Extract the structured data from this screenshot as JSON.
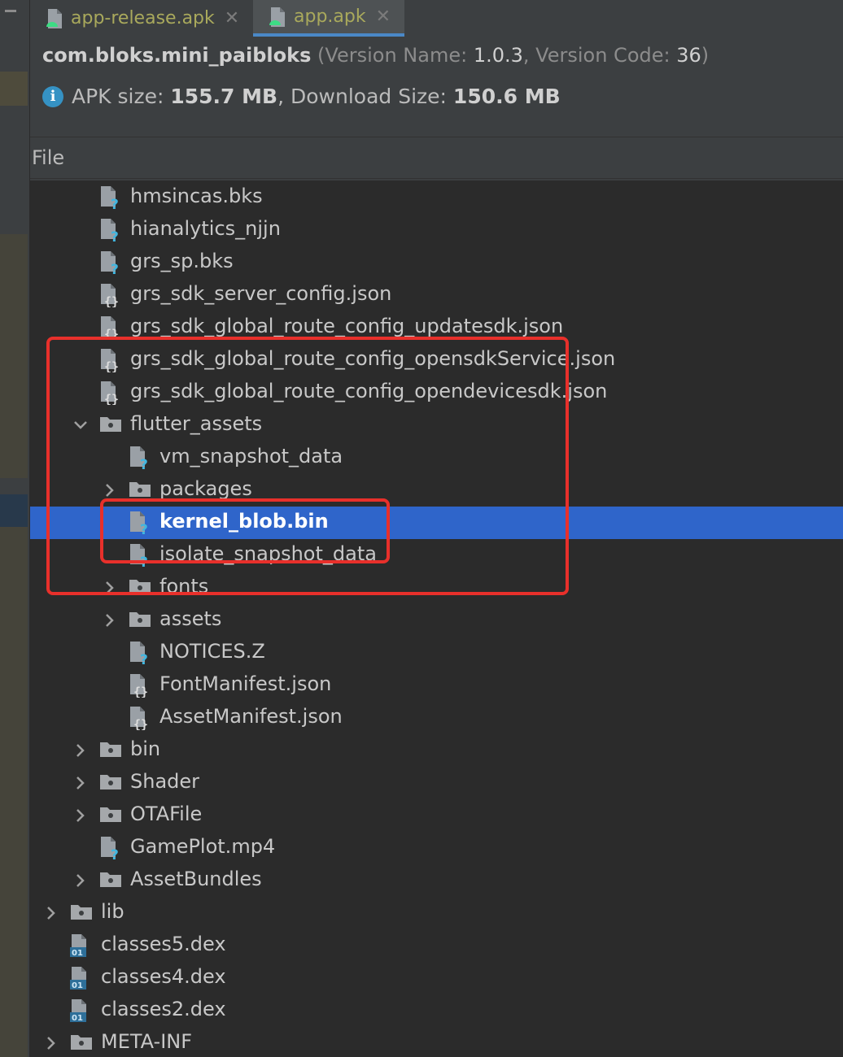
{
  "tabs": [
    {
      "label": "app-release.apk",
      "active": false
    },
    {
      "label": "app.apk",
      "active": true
    }
  ],
  "header": {
    "package": "com.bloks.mini_paibloks",
    "version_name_label": "Version Name:",
    "version_name": "1.0.3",
    "version_code_label": "Version Code:",
    "version_code": "36",
    "apk_size_label": "APK size:",
    "apk_size": "155.7 MB",
    "download_size_label": "Download Size:",
    "download_size": "150.6 MB"
  },
  "tree_header": "File",
  "tree": [
    {
      "label": "hmsincas.bks",
      "icon": "unknown-file-icon",
      "level": 2
    },
    {
      "label": "hianalytics_njjn",
      "icon": "unknown-file-icon",
      "level": 2
    },
    {
      "label": "grs_sp.bks",
      "icon": "unknown-file-icon",
      "level": 2
    },
    {
      "label": "grs_sdk_server_config.json",
      "icon": "json-file-icon",
      "level": 2
    },
    {
      "label": "grs_sdk_global_route_config_updatesdk.json",
      "icon": "json-file-icon",
      "level": 2
    },
    {
      "label": "grs_sdk_global_route_config_opensdkService.json",
      "icon": "json-file-icon",
      "level": 2
    },
    {
      "label": "grs_sdk_global_route_config_opendevicesdk.json",
      "icon": "json-file-icon",
      "level": 2
    },
    {
      "label": "flutter_assets",
      "icon": "folder-icon",
      "level": 2,
      "expandable": true,
      "expanded": true
    },
    {
      "label": "vm_snapshot_data",
      "icon": "unknown-file-icon",
      "level": 3
    },
    {
      "label": "packages",
      "icon": "folder-icon",
      "level": 3,
      "expandable": true,
      "expanded": false
    },
    {
      "label": "kernel_blob.bin",
      "icon": "unknown-file-icon",
      "level": 3,
      "selected": true
    },
    {
      "label": "isolate_snapshot_data",
      "icon": "unknown-file-icon",
      "level": 3
    },
    {
      "label": "fonts",
      "icon": "folder-icon",
      "level": 3,
      "expandable": true,
      "expanded": false
    },
    {
      "label": "assets",
      "icon": "folder-icon",
      "level": 3,
      "expandable": true,
      "expanded": false
    },
    {
      "label": "NOTICES.Z",
      "icon": "unknown-file-icon",
      "level": 3
    },
    {
      "label": "FontManifest.json",
      "icon": "json-file-icon",
      "level": 3
    },
    {
      "label": "AssetManifest.json",
      "icon": "json-file-icon",
      "level": 3
    },
    {
      "label": "bin",
      "icon": "folder-icon",
      "level": 2,
      "expandable": true,
      "expanded": false
    },
    {
      "label": "Shader",
      "icon": "folder-icon",
      "level": 2,
      "expandable": true,
      "expanded": false
    },
    {
      "label": "OTAFile",
      "icon": "folder-icon",
      "level": 2,
      "expandable": true,
      "expanded": false
    },
    {
      "label": "GamePlot.mp4",
      "icon": "unknown-file-icon",
      "level": 2
    },
    {
      "label": "AssetBundles",
      "icon": "folder-icon",
      "level": 2,
      "expandable": true,
      "expanded": false
    },
    {
      "label": "lib",
      "icon": "folder-icon",
      "level": 1,
      "expandable": true,
      "expanded": false
    },
    {
      "label": "classes5.dex",
      "icon": "dex-file-icon",
      "level": 1
    },
    {
      "label": "classes4.dex",
      "icon": "dex-file-icon",
      "level": 1
    },
    {
      "label": "classes2.dex",
      "icon": "dex-file-icon",
      "level": 1
    },
    {
      "label": "META-INF",
      "icon": "folder-icon",
      "level": 1,
      "expandable": true,
      "expanded": false
    }
  ],
  "colors": {
    "selection": "#2f65ca",
    "annotation_red": "#e8302b",
    "tab_text": "#a9a95c",
    "info_blue": "#3592c4"
  }
}
